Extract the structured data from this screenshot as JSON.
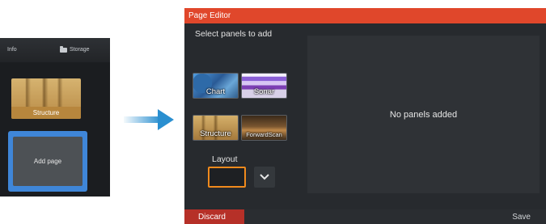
{
  "left_panel": {
    "topbar": {
      "info_label": "Info",
      "storage_label": "Storage"
    },
    "structure_tile_label": "Structure",
    "add_page_label": "Add page"
  },
  "editor": {
    "title": "Page Editor",
    "select_panels_text": "Select panels to add",
    "panels": [
      {
        "label": "Chart"
      },
      {
        "label": "Sonar"
      },
      {
        "label": "Structure"
      },
      {
        "label": "ForwardScan"
      }
    ],
    "layout_label": "Layout",
    "empty_message": "No panels added",
    "discard_label": "Discard",
    "save_label": "Save"
  },
  "colors": {
    "accent_orange": "#e0472b",
    "discard_red": "#b63028",
    "selected_orange": "#f08a1d",
    "highlight_blue": "#3f86d8",
    "arrow_blue": "#2a8fd0"
  }
}
